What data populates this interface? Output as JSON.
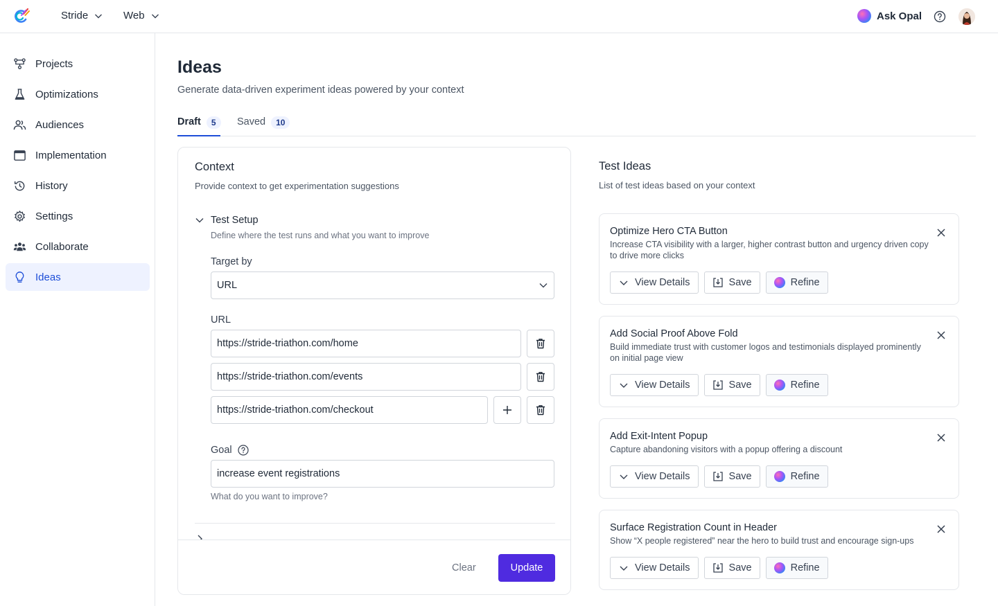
{
  "header": {
    "project": "Stride",
    "platform": "Web",
    "ask_opal": "Ask Opal"
  },
  "sidebar": {
    "items": [
      {
        "label": "Projects",
        "icon": "projects-icon"
      },
      {
        "label": "Optimizations",
        "icon": "flask-icon"
      },
      {
        "label": "Audiences",
        "icon": "users-icon"
      },
      {
        "label": "Implementation",
        "icon": "window-icon"
      },
      {
        "label": "History",
        "icon": "history-icon"
      },
      {
        "label": "Settings",
        "icon": "gear-icon"
      },
      {
        "label": "Collaborate",
        "icon": "team-icon"
      },
      {
        "label": "Ideas",
        "icon": "lightbulb-icon",
        "active": true
      }
    ]
  },
  "page": {
    "title": "Ideas",
    "subtitle": "Generate data-driven experiment ideas powered by your context"
  },
  "tabs": [
    {
      "label": "Draft",
      "count": "5",
      "active": true
    },
    {
      "label": "Saved",
      "count": "10",
      "active": false
    }
  ],
  "context": {
    "title": "Context",
    "subtitle": "Provide context to get experimentation suggestions",
    "section": {
      "title": "Test Setup",
      "subtitle": "Define where the test runs and what you want to improve"
    },
    "target_label": "Target by",
    "target_value": "URL",
    "url_label": "URL",
    "urls": [
      "https://stride-triathon.com/home",
      "https://stride-triathon.com/events",
      "https://stride-triathon.com/checkout"
    ],
    "goal_label": "Goal",
    "goal_value": "increase event registrations",
    "goal_help": "What do you want to improve?",
    "clear_label": "Clear",
    "update_label": "Update"
  },
  "test_ideas": {
    "title": "Test Ideas",
    "subtitle": "List of test ideas based on your context",
    "view_details_label": "View Details",
    "save_label": "Save",
    "refine_label": "Refine",
    "items": [
      {
        "title": "Optimize Hero CTA Button",
        "desc": "Increase CTA visibility with a larger, higher contrast button and urgency driven copy to drive more clicks"
      },
      {
        "title": "Add Social Proof Above Fold",
        "desc": "Build immediate trust with customer logos and testimonials displayed prominently on initial page view"
      },
      {
        "title": "Add Exit-Intent Popup",
        "desc": "Capture abandoning visitors with a popup offering a discount"
      },
      {
        "title": "Surface Registration Count in Header",
        "desc": "Show “X people registered” near the hero to build trust and encourage sign-ups"
      }
    ]
  },
  "colors": {
    "accent": "#1d4ed8",
    "primary_button": "#4f2be0",
    "active_nav_bg": "#eef2ff"
  }
}
